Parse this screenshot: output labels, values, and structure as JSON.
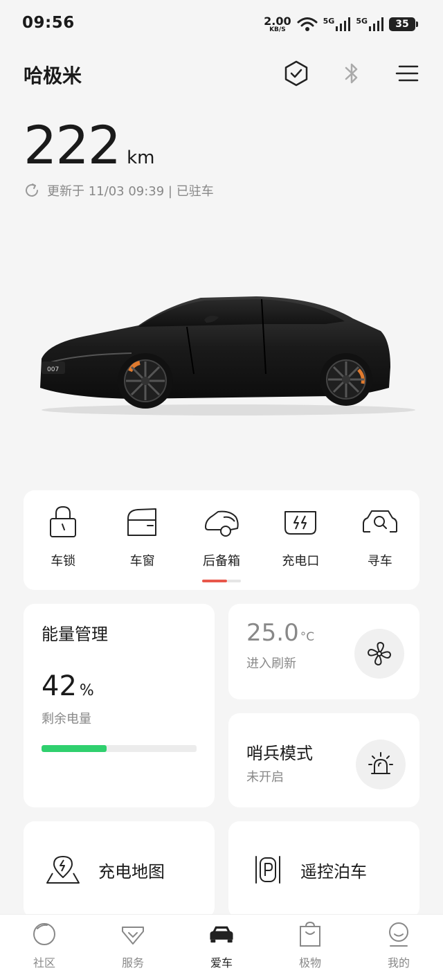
{
  "status_bar": {
    "time": "09:56",
    "net_speed_value": "2.00",
    "net_speed_unit": "KB/S",
    "signal1": "5G",
    "signal2": "5G",
    "battery": "35"
  },
  "header": {
    "title": "哈极米",
    "icons": [
      "shield-check-icon",
      "bluetooth-icon",
      "menu-icon"
    ]
  },
  "vehicle": {
    "range_value": "222",
    "range_unit": "km",
    "update_text": "更新于 11/03 09:39 | 已驻车",
    "plate_badge": "007"
  },
  "quick_actions": [
    {
      "label": "车锁",
      "icon": "lock-icon"
    },
    {
      "label": "车窗",
      "icon": "window-icon"
    },
    {
      "label": "后备箱",
      "icon": "trunk-icon"
    },
    {
      "label": "充电口",
      "icon": "charge-port-icon"
    },
    {
      "label": "寻车",
      "icon": "find-car-icon"
    }
  ],
  "energy": {
    "title": "能量管理",
    "percent": "42",
    "percent_unit": "%",
    "sub": "剩余电量",
    "level": 0.42,
    "bar_color": "#2fd06e"
  },
  "climate": {
    "temp": "25.0",
    "unit": "°C",
    "sub": "进入刷新",
    "icon": "fan-icon"
  },
  "sentry": {
    "title": "哨兵模式",
    "sub": "未开启",
    "icon": "siren-icon"
  },
  "tiles": [
    {
      "label": "充电地图",
      "icon": "charge-map-icon"
    },
    {
      "label": "遥控泊车",
      "icon": "remote-parking-icon"
    }
  ],
  "tabbar": [
    {
      "label": "社区",
      "icon": "community-icon",
      "active": false
    },
    {
      "label": "服务",
      "icon": "service-icon",
      "active": false
    },
    {
      "label": "爱车",
      "icon": "car-icon",
      "active": true
    },
    {
      "label": "极物",
      "icon": "shop-bag-icon",
      "active": false
    },
    {
      "label": "我的",
      "icon": "profile-icon",
      "active": false
    }
  ],
  "colors": {
    "accent_red": "#e8574b",
    "battery_green": "#2fd06e",
    "background": "#f5f5f5"
  }
}
